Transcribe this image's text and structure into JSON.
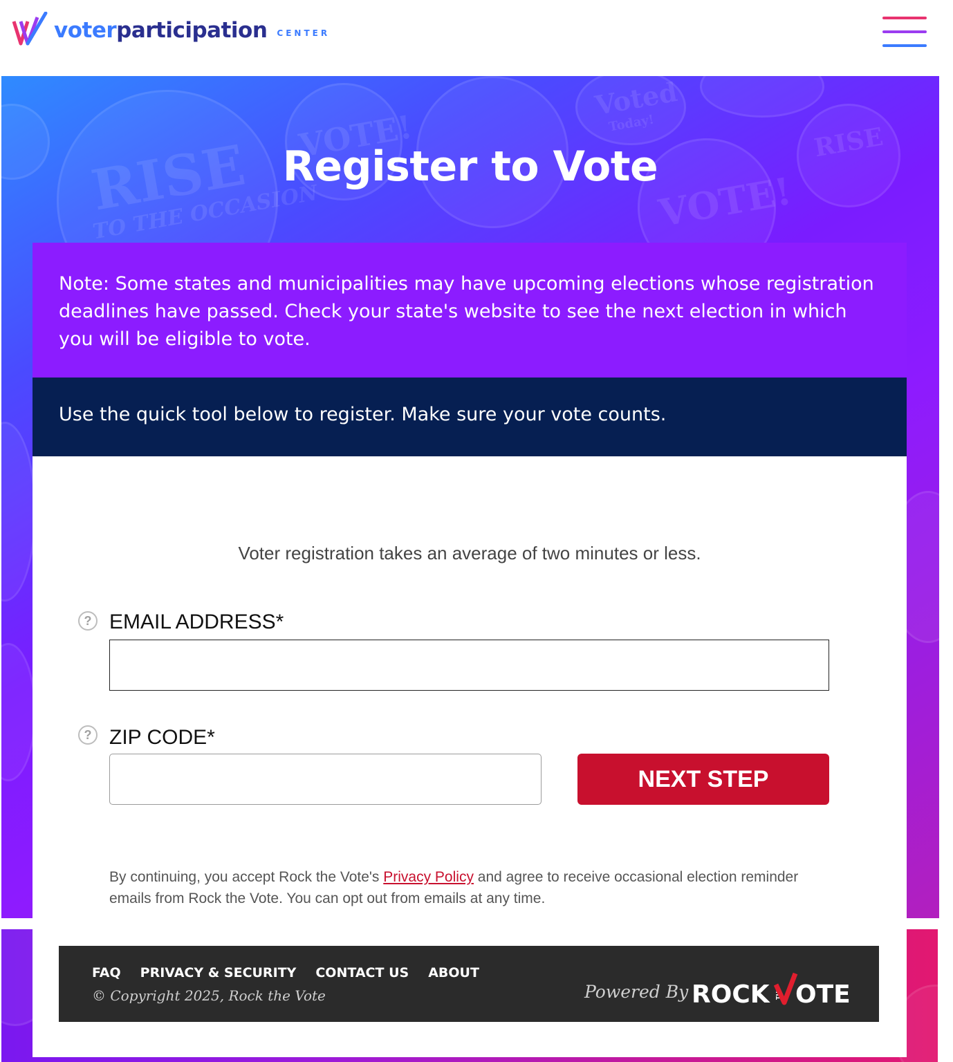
{
  "header": {
    "logo_word_1": "voter",
    "logo_word_2": "participation",
    "logo_center": "CENTER",
    "menu_icon": "hamburger-menu-icon",
    "menu_colors": [
      "#e8336f",
      "#9b3cf0",
      "#3b7bff"
    ]
  },
  "hero": {
    "title": "Register to Vote",
    "badge_texts": [
      "RISE",
      "TO THE OCCASION",
      "VOTE!",
      "Voted",
      "Today!",
      "VOTE!",
      "RISE"
    ]
  },
  "card": {
    "note": "Note: Some states and municipalities may have upcoming elections whose registration deadlines have passed. Check your state's website to see the next election in which you will be eligible to vote.",
    "quick": "Use the quick tool below to register. Make sure your vote counts.",
    "average": "Voter registration takes an average of two minutes or less."
  },
  "form": {
    "email_label": "EMAIL ADDRESS*",
    "email_value": "",
    "zip_label": "ZIP CODE*",
    "zip_value": "",
    "help_glyph": "?",
    "next_label": "NEXT STEP"
  },
  "consent": {
    "before": "By continuing, you accept Rock the Vote's ",
    "link": "Privacy Policy",
    "after": " and agree to receive occasional election reminder emails from Rock the Vote. You can opt out from emails at any time."
  },
  "footer": {
    "links": [
      "FAQ",
      "PRIVACY & SECURITY",
      "CONTACT US",
      "ABOUT"
    ],
    "copyright": "© Copyright 2025, Rock the Vote",
    "powered_by": "Powered By",
    "brand_left": "ROCK",
    "brand_the": "THE",
    "brand_right": "OTE"
  },
  "colors": {
    "accent_purple": "#8c1cff",
    "navy": "#061f52",
    "button_red": "#c8102e",
    "footer_bg": "#2b2b2b"
  }
}
